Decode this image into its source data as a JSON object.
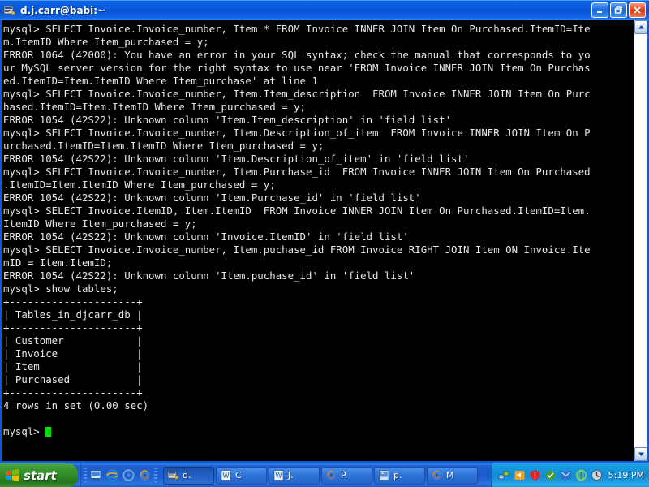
{
  "window": {
    "title": "d.j.carr@babi:~",
    "icon": "terminal-icon",
    "buttons": {
      "minimize": "Minimize",
      "maximize": "Restore",
      "close": "Close"
    }
  },
  "terminal": {
    "prompt": "mysql>",
    "cursor": "block-cursor",
    "lines": [
      "mysql> SELECT Invoice.Invoice_number, Item * FROM Invoice INNER JOIN Item On Purchased.ItemID=Ite",
      "m.ItemID Where Item_purchased = y;",
      "ERROR 1064 (42000): You have an error in your SQL syntax; check the manual that corresponds to yo",
      "ur MySQL server version for the right syntax to use near 'FROM Invoice INNER JOIN Item On Purchas",
      "ed.ItemID=Item.ItemID Where Item_purchase' at line 1",
      "mysql> SELECT Invoice.Invoice_number, Item.Item_description  FROM Invoice INNER JOIN Item On Purc",
      "hased.ItemID=Item.ItemID Where Item_purchased = y;",
      "ERROR 1054 (42S22): Unknown column 'Item.Item_description' in 'field list'",
      "mysql> SELECT Invoice.Invoice_number, Item.Description_of_item  FROM Invoice INNER JOIN Item On P",
      "urchased.ItemID=Item.ItemID Where Item_purchased = y;",
      "ERROR 1054 (42S22): Unknown column 'Item.Description_of_item' in 'field list'",
      "mysql> SELECT Invoice.Invoice_number, Item.Purchase_id  FROM Invoice INNER JOIN Item On Purchased",
      ".ItemID=Item.ItemID Where Item_purchased = y;",
      "ERROR 1054 (42S22): Unknown column 'Item.Purchase_id' in 'field list'",
      "mysql> SELECT Invoice.ItemID, Item.ItemID  FROM Invoice INNER JOIN Item On Purchased.ItemID=Item.",
      "ItemID Where Item_purchased = y;",
      "ERROR 1054 (42S22): Unknown column 'Invoice.ItemID' in 'field list'",
      "mysql> SELECT Invoice.Invoice_number, Item.puchase_id FROM Invoice RIGHT JOIN Item ON Invoice.Ite",
      "mID = Item.ItemID;",
      "ERROR 1054 (42S22): Unknown column 'Item.puchase_id' in 'field list'",
      "mysql> show tables;",
      "+---------------------+",
      "| Tables_in_djcarr_db |",
      "+---------------------+",
      "| Customer            |",
      "| Invoice             |",
      "| Item                |",
      "| Purchased           |",
      "+---------------------+",
      "4 rows in set (0.00 sec)",
      ""
    ],
    "last_prompt": "mysql> "
  },
  "table_result": {
    "column_header": "Tables_in_djcarr_db",
    "rows": [
      "Customer",
      "Invoice",
      "Item",
      "Purchased"
    ],
    "footer": "4 rows in set (0.00 sec)"
  },
  "scrollbar": {
    "up_arrow": "scroll-up-icon",
    "down_arrow": "scroll-down-icon"
  },
  "taskbar": {
    "start_label": "start",
    "quick_launch": [
      {
        "name": "show-desktop-icon"
      },
      {
        "name": "internet-explorer-icon"
      },
      {
        "name": "media-player-icon"
      },
      {
        "name": "firefox-icon"
      }
    ],
    "tasks": [
      {
        "label": "d.",
        "icon": "terminal-icon",
        "active": true
      },
      {
        "label": "C",
        "icon": "word-document-icon",
        "active": false
      },
      {
        "label": "J.",
        "icon": "word-document-icon",
        "active": false
      },
      {
        "label": "P.",
        "icon": "firefox-icon",
        "active": false
      },
      {
        "label": "p.",
        "icon": "image-file-icon",
        "active": false
      },
      {
        "label": "M",
        "icon": "firefox-icon",
        "active": false
      }
    ],
    "tray_icons": [
      {
        "name": "network-icon"
      },
      {
        "name": "volume-icon"
      },
      {
        "name": "security-shield-icon"
      },
      {
        "name": "update-icon"
      },
      {
        "name": "messenger-icon"
      },
      {
        "name": "browser-tray-icon"
      },
      {
        "name": "clock-tray-icon"
      }
    ],
    "clock": "5:19 PM"
  },
  "colors": {
    "titlebar_blue": "#0a5ade",
    "taskbar_blue": "#1e5ecb",
    "start_green": "#2f8a26",
    "terminal_bg": "#000000",
    "terminal_fg": "#e8e8e8",
    "cursor_green": "#00e000",
    "close_red": "#e14a21"
  }
}
